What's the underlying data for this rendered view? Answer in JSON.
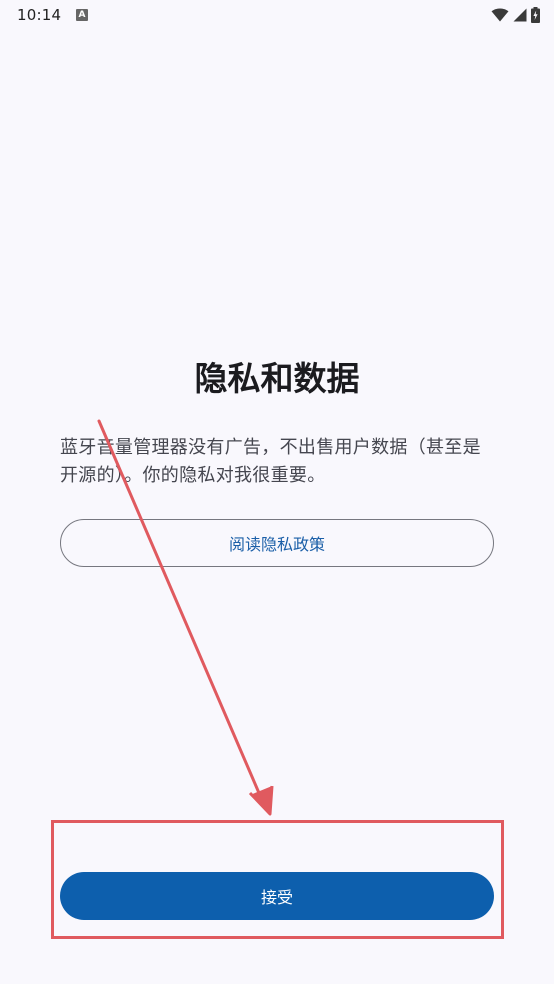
{
  "status_bar": {
    "time": "10:14",
    "notification_icon": "a-letter-icon",
    "wifi_icon": "wifi-icon",
    "signal_icon": "signal-icon",
    "battery_icon": "battery-charging-icon"
  },
  "main": {
    "title": "隐私和数据",
    "description": "蓝牙音量管理器没有广告，不出售用户数据（甚至是开源的）。你的隐私对我很重要。",
    "privacy_policy_label": "阅读隐私政策",
    "accept_label": "接受"
  },
  "colors": {
    "background": "#f9f8fd",
    "primary": "#0d5fad",
    "link_text": "#1b5fa8",
    "outline": "#76777f",
    "annotation": "#e05a5f"
  }
}
